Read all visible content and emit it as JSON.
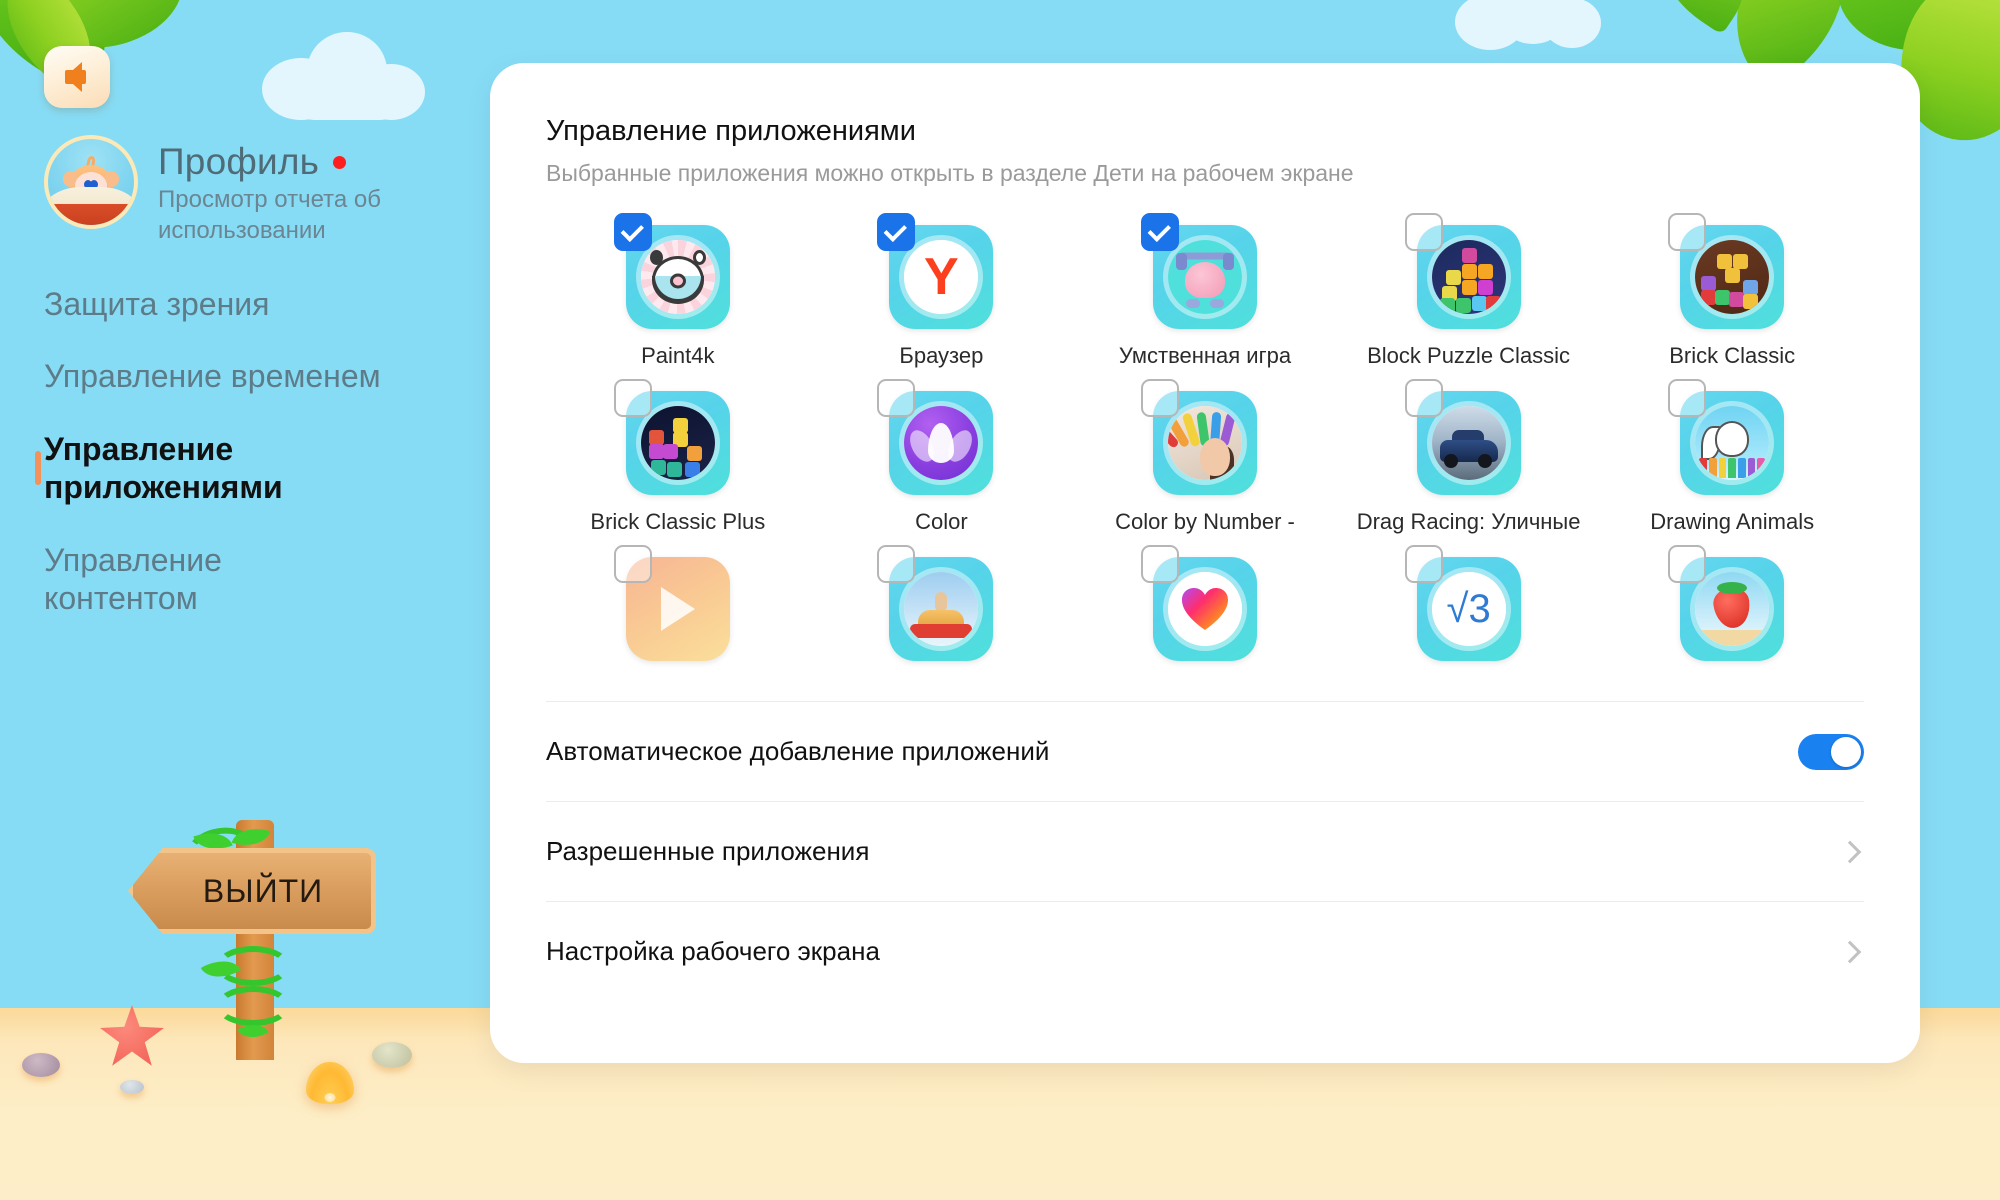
{
  "header": {
    "back_icon": "back-arrow-icon",
    "profile_title": "Профиль",
    "profile_subtitle": "Просмотр отчета об использовании",
    "profile_badge": "unread-dot"
  },
  "sidebar": {
    "items": [
      {
        "label": "Защита зрения",
        "active": false
      },
      {
        "label": "Управление временем",
        "active": false
      },
      {
        "label": "Управление приложениями",
        "active": true
      },
      {
        "label": "Управление контентом",
        "active": false
      }
    ],
    "exit_label": "ВЫЙТИ"
  },
  "main": {
    "title": "Управление приложениями",
    "subtitle": "Выбранные приложения можно открыть в разделе Дети на рабочем экране",
    "apps": [
      {
        "name": "Paint4k",
        "checked": true,
        "art": "donut"
      },
      {
        "name": "Браузер",
        "checked": true,
        "art": "ya"
      },
      {
        "name": "Умственная игра",
        "checked": true,
        "art": "brain"
      },
      {
        "name": "Block Puzzle Classic",
        "checked": false,
        "art": "blocks"
      },
      {
        "name": "Brick Classic",
        "checked": false,
        "art": "brick"
      },
      {
        "name": "Brick Classic Plus",
        "checked": false,
        "art": "blocks-dark"
      },
      {
        "name": "Color",
        "checked": false,
        "art": "lotus"
      },
      {
        "name": "Color by Number -",
        "checked": false,
        "art": "indian"
      },
      {
        "name": "Drag Racing: Уличные",
        "checked": false,
        "art": "car"
      },
      {
        "name": "Drawing Animals",
        "checked": false,
        "art": "animals"
      },
      {
        "name": "",
        "checked": false,
        "art": "play"
      },
      {
        "name": "",
        "checked": false,
        "art": "burger"
      },
      {
        "name": "",
        "checked": false,
        "art": "heart"
      },
      {
        "name": "",
        "checked": false,
        "art": "sqrt"
      },
      {
        "name": "",
        "checked": false,
        "art": "berry"
      }
    ],
    "rows": [
      {
        "label": "Автоматическое добавление приложений",
        "control": "toggle",
        "toggle_on": true
      },
      {
        "label": "Разрешенные приложения",
        "control": "chevron"
      },
      {
        "label": "Настройка рабочего экрана",
        "control": "chevron"
      }
    ]
  },
  "colors": {
    "sky": "#87dcf5",
    "sand": "#fdeec7",
    "accent_blue": "#1a73e8",
    "toggle_on": "#1a82f0",
    "active_marker": "#f2915a",
    "badge_red": "#ff1f1f"
  }
}
